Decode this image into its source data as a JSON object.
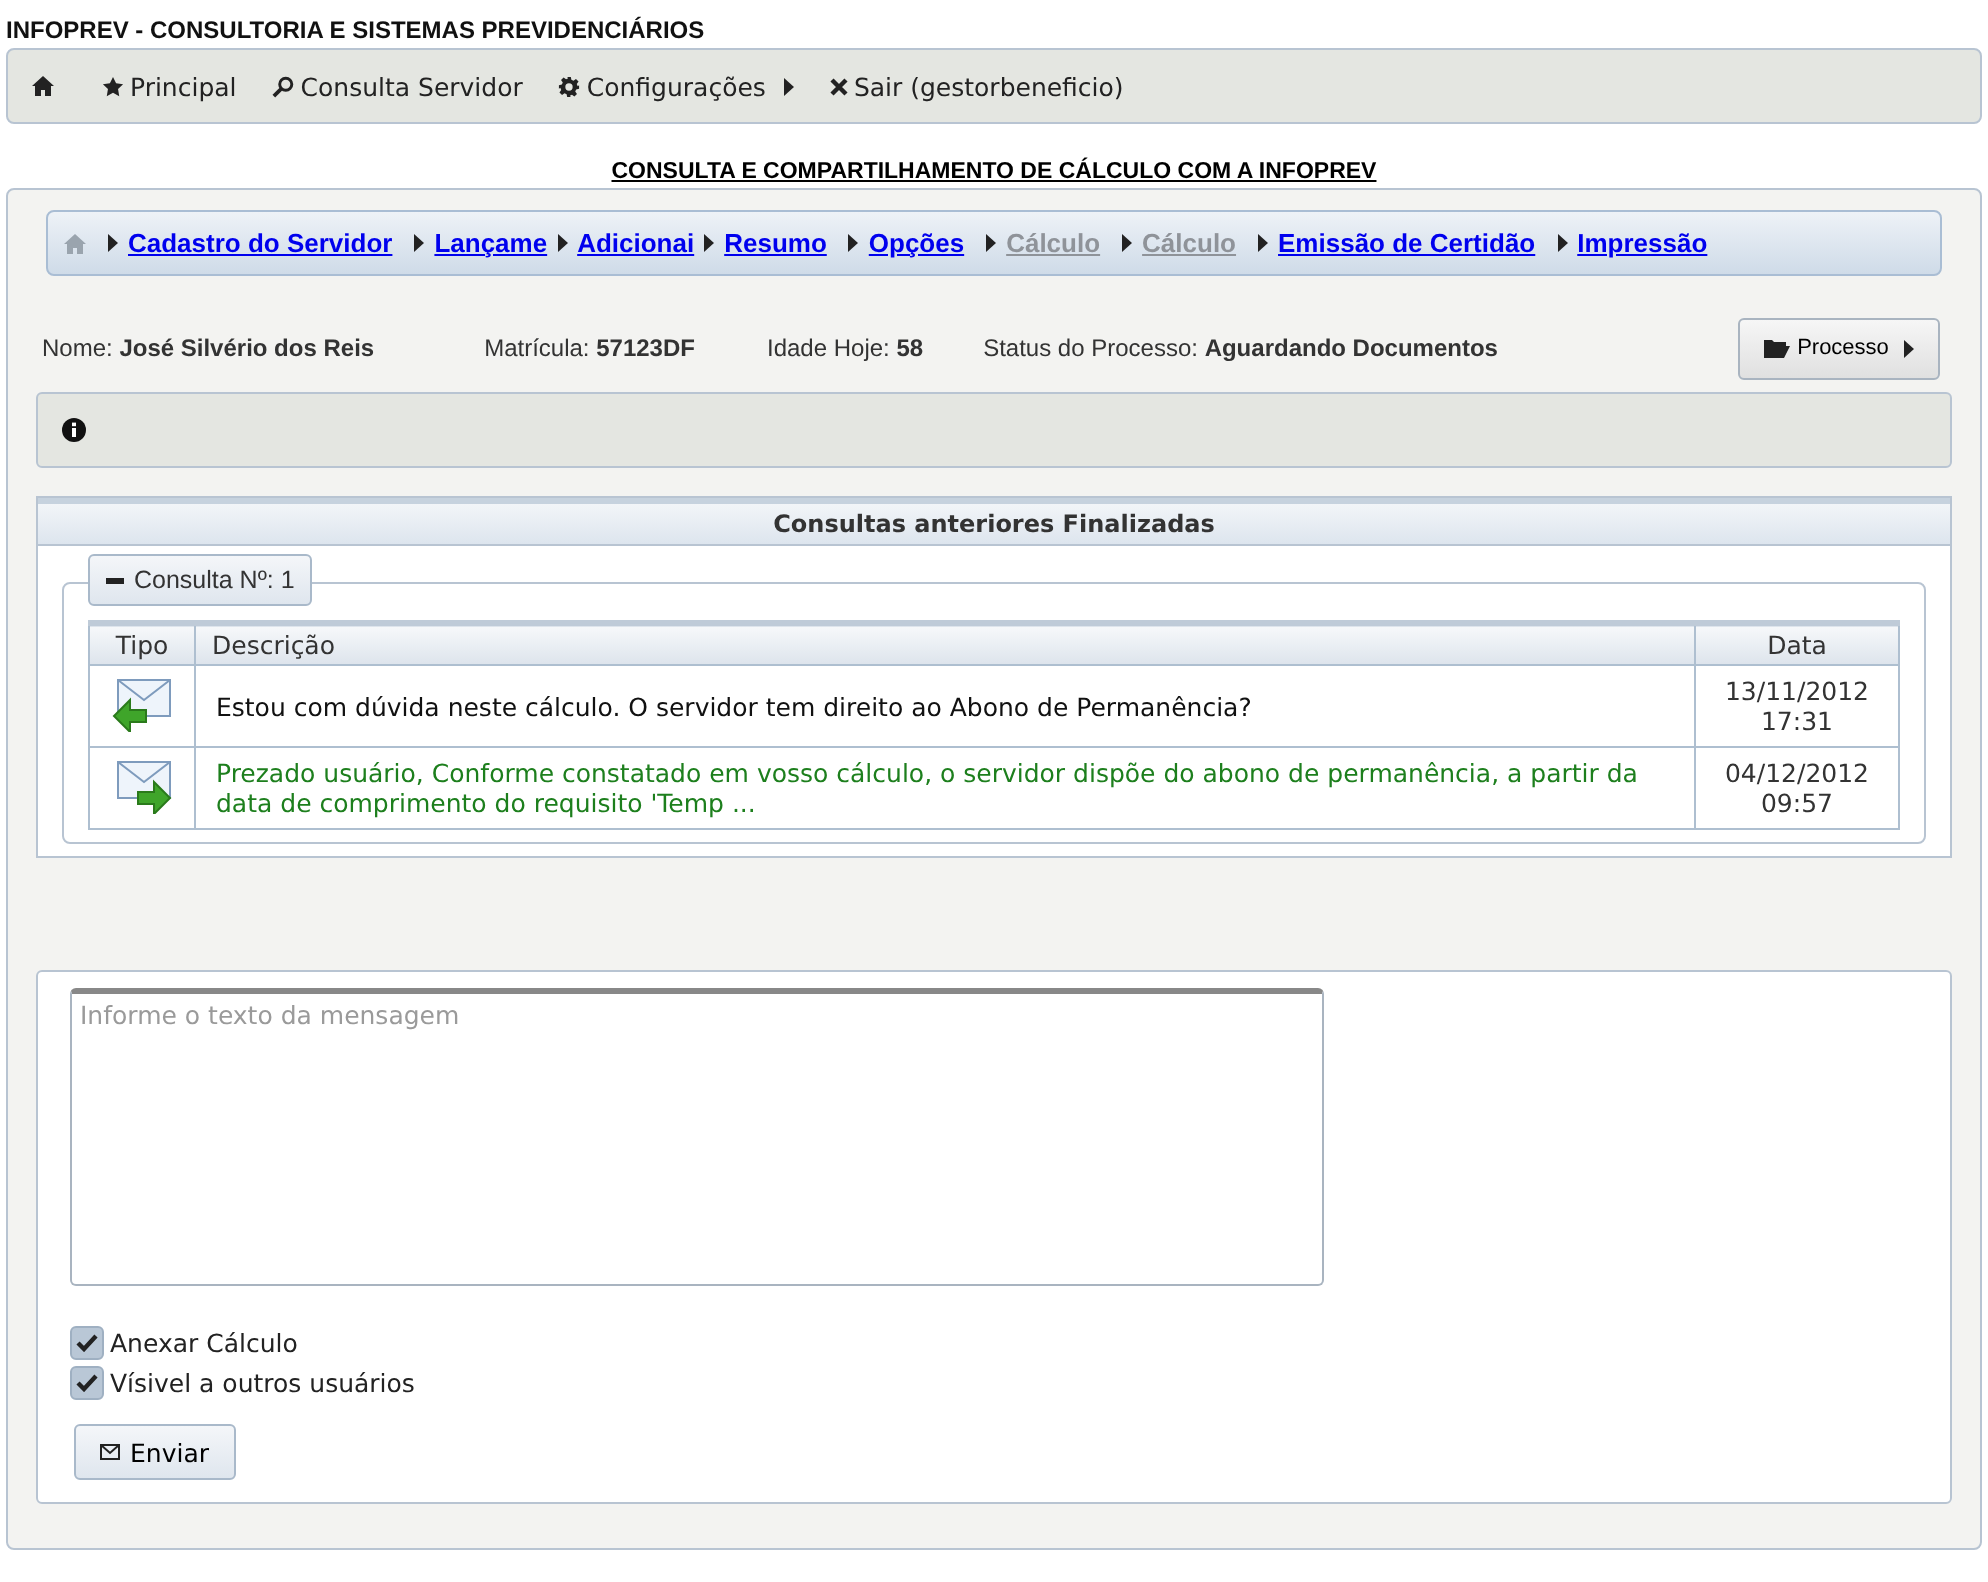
{
  "app_title": "INFOPREV - CONSULTORIA E SISTEMAS PREVIDENCIÁRIOS",
  "menu": [
    {
      "kind": "home"
    },
    {
      "kind": "star",
      "label": "Principal"
    },
    {
      "kind": "search",
      "label": "Consulta Servidor"
    },
    {
      "kind": "gear",
      "label": "Configurações",
      "submenu": true
    },
    {
      "kind": "close",
      "label": "Sair (gestorbeneficio)"
    }
  ],
  "page_heading": "CONSULTA E COMPARTILHAMENTO DE CÁLCULO COM A INFOPREV",
  "steps": [
    {
      "label": "Cadastro do Servidor",
      "disabled": false
    },
    {
      "label": "Lançame",
      "disabled": false
    },
    {
      "label": "Adicionai",
      "disabled": false
    },
    {
      "label": "Resumo",
      "disabled": false
    },
    {
      "label": "Opções",
      "disabled": false
    },
    {
      "label": "Cálculo",
      "disabled": true
    },
    {
      "label": "Cálculo",
      "disabled": true
    },
    {
      "label": "Emissão de Certidão",
      "disabled": false
    },
    {
      "label": "Impressão",
      "disabled": false
    }
  ],
  "info": [
    {
      "label": "Nome:",
      "value": "José Silvério dos Reis"
    },
    {
      "label": "Matrícula:",
      "value": "57123DF"
    },
    {
      "label": "Idade Hoje:",
      "value": "58"
    },
    {
      "label": "Status do Processo:",
      "value": "Aguardando Documentos"
    }
  ],
  "process_button": "Processo",
  "consultas": {
    "title": "Consultas anteriores Finalizadas",
    "legend": "Consulta Nº: 1",
    "expanded": true,
    "columns": [
      "Tipo",
      "Descrição",
      "Data"
    ],
    "rows": [
      {
        "kind": "incoming",
        "description": "Estou com dúvida neste cálculo. O servidor tem direito ao Abono de Permanência?",
        "date": "13/11/2012",
        "time": "17:31"
      },
      {
        "kind": "outgoing",
        "description": "Prezado usuário, Conforme constatado em vosso cálculo, o servidor dispõe do abono de permanência, a partir da data de comprimento do requisito 'Temp ...",
        "date": "04/12/2012",
        "time": "09:57"
      }
    ]
  },
  "message": {
    "placeholder": "Informe o texto da mensagem"
  },
  "options": [
    {
      "label": "Anexar Cálculo",
      "checked": true
    },
    {
      "label": "Vísivel a outros usuários",
      "checked": true
    }
  ],
  "send_button": "Enviar"
}
